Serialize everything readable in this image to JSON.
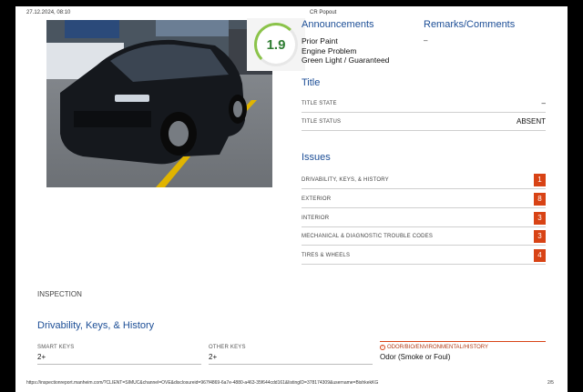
{
  "header": {
    "print_date": "27.12.2024, 08:10",
    "print_title": "CR Popout"
  },
  "grade": {
    "value": "1.9"
  },
  "announcements": {
    "title": "Announcements",
    "items": [
      "Prior Paint",
      "Engine Problem",
      "Green Light / Guaranteed"
    ]
  },
  "remarks": {
    "title": "Remarks/Comments",
    "value": "–"
  },
  "title_section": {
    "heading": "Title",
    "rows": [
      {
        "label": "TITLE STATE",
        "value": "–"
      },
      {
        "label": "TITLE STATUS",
        "value": "ABSENT"
      }
    ]
  },
  "issues": {
    "heading": "Issues",
    "items": [
      {
        "label": "DRIVABILITY, KEYS, & HISTORY",
        "count": "1"
      },
      {
        "label": "EXTERIOR",
        "count": "8"
      },
      {
        "label": "INTERIOR",
        "count": "3"
      },
      {
        "label": "MECHANICAL & DIAGNOSTIC TROUBLE CODES",
        "count": "3"
      },
      {
        "label": "TIRES & WHEELS",
        "count": "4"
      }
    ],
    "badge_color": "#d84315"
  },
  "inspection": {
    "label": "INSPECTION",
    "section_title": "Drivability, Keys, & History",
    "fields": [
      {
        "label": "SMART KEYS",
        "value": "2+"
      },
      {
        "label": "OTHER KEYS",
        "value": "2+"
      }
    ],
    "alert_field": {
      "label": "ODOR/BIO/ENVIRONMENTAL/HISTORY",
      "value": "Odor (Smoke or Foul)"
    }
  },
  "footer": {
    "url": "https://inspectionreport.manheim.com/?CLIENT=SIMUC&channel=OVE&disclosureid=967f4869-6a7e-4880-a463-35f644cdd161&listingID=378174309&username=BishkekKG",
    "page": "2/5"
  },
  "colors": {
    "heading_blue": "#1c4e96",
    "alert_red": "#d84315",
    "grade_green": "#2e7d32"
  }
}
